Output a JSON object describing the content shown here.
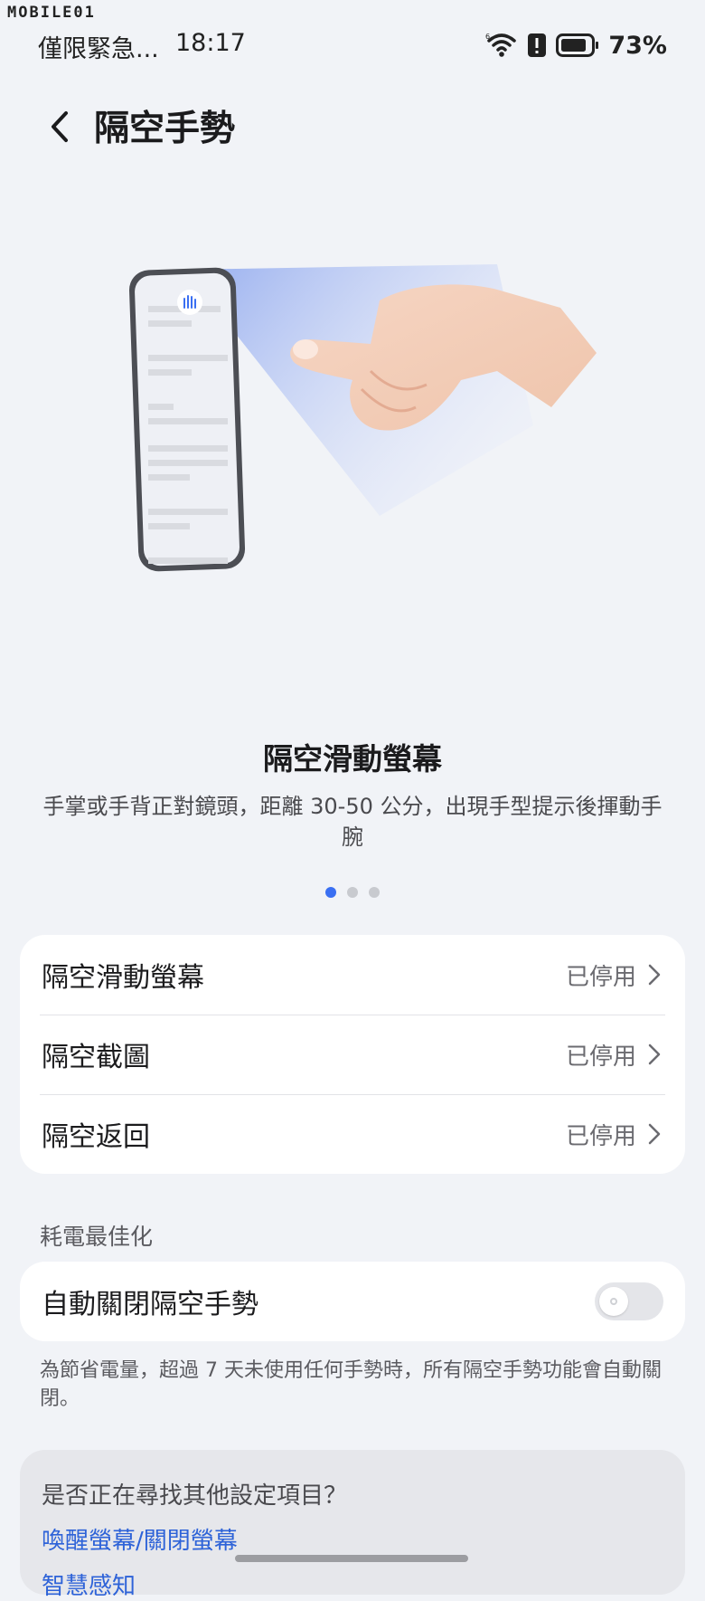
{
  "watermark": "MOBILE01",
  "status_bar": {
    "carrier": "僅限緊急...",
    "time": "18:17",
    "battery": "73%",
    "icons": [
      "wifi-icon",
      "alert-icon",
      "battery-icon"
    ]
  },
  "header": {
    "back_icon": "chevron-left-icon",
    "title": "隔空手勢"
  },
  "carousel": {
    "title": "隔空滑動螢幕",
    "description": "手掌或手背正對鏡頭，距離 30-50 公分，出現手型提示後揮動手腕",
    "page_count": 3,
    "active_page": 1
  },
  "gesture_list": [
    {
      "label": "隔空滑動螢幕",
      "status": "已停用"
    },
    {
      "label": "隔空截圖",
      "status": "已停用"
    },
    {
      "label": "隔空返回",
      "status": "已停用"
    }
  ],
  "power_section": {
    "label": "耗電最佳化",
    "toggle_label": "自動關閉隔空手勢",
    "toggle_on": false,
    "footnote": "為節省電量，超過 7 天未使用任何手勢時，所有隔空手勢功能會自動關閉。"
  },
  "suggestions": {
    "title": "是否正在尋找其他設定項目？",
    "links": [
      "喚醒螢幕/關閉螢幕",
      "智慧感知"
    ]
  },
  "colors": {
    "accent": "#3a6ff2",
    "link": "#2e63d8",
    "background": "#f1f3f7"
  }
}
